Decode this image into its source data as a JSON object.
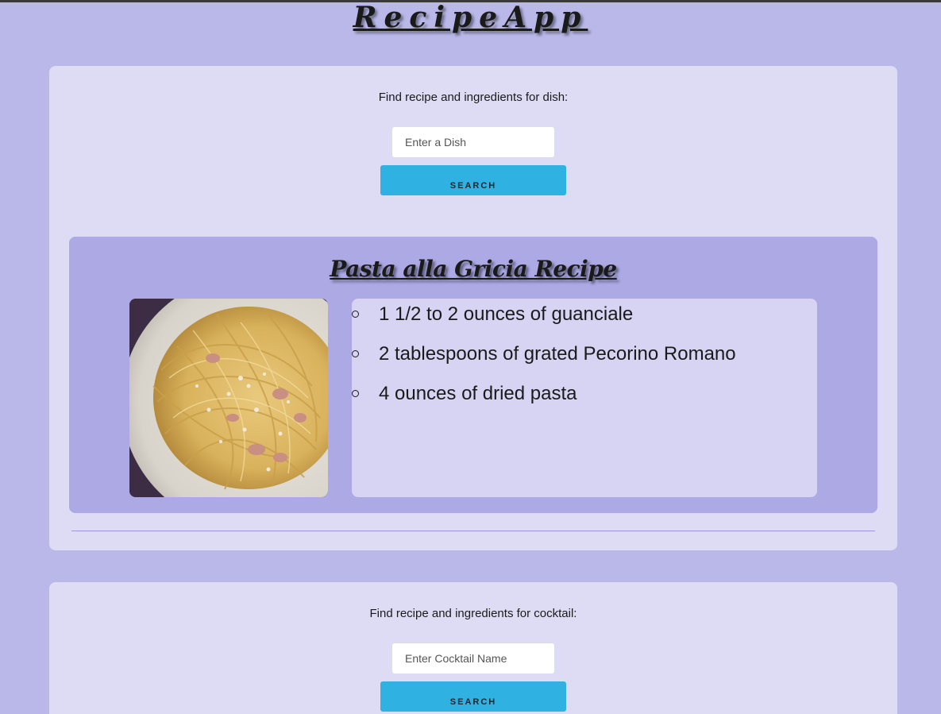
{
  "app": {
    "title": "RecipeApp"
  },
  "dish_search": {
    "prompt": "Find recipe and ingredients for dish:",
    "placeholder": "Enter a Dish",
    "button_label": "SEARCH"
  },
  "result": {
    "title": "Pasta alla Gricia Recipe",
    "image_subject": "spaghetti with guanciale and pecorino",
    "ingredients": [
      "1 1/2 to 2 ounces of guanciale",
      "2 tablespoons of grated Pecorino Romano",
      "4 ounces of dried pasta"
    ]
  },
  "cocktail_search": {
    "prompt": "Find recipe and ingredients for cocktail:",
    "placeholder": "Enter Cocktail Name",
    "button_label": "SEARCH"
  },
  "colors": {
    "page_bg": "#b9b8e8",
    "card_bg": "#dddcf4",
    "result_bg": "#aca9e4",
    "ingredients_bg": "#d6d4f2",
    "button_accent": "#2fb2e2"
  }
}
